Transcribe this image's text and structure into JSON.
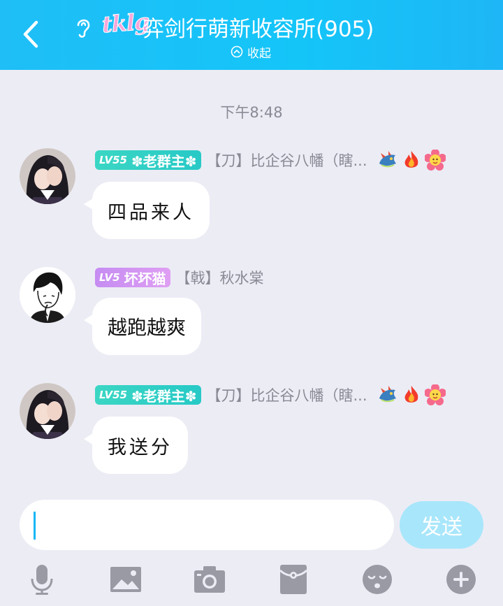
{
  "header": {
    "back_label": "返回",
    "logo_text": "tklg",
    "title": "弈剑行萌新收容所(905)",
    "collapse_label": "收起"
  },
  "chat": {
    "timestamp": "下午8:48",
    "messages": [
      {
        "badge_level": "LV55",
        "badge_title": "✽老群主✽",
        "badge_color": "#2ecdc6",
        "sender": "【刀】比企谷八幡（瞎...",
        "text": "四品来人",
        "avatar_icon": "anime-couple-avatar"
      },
      {
        "badge_level": "LV5",
        "badge_title": "坏坏猫",
        "badge_color": "#d596f3",
        "sender": "【戟】秋水棠",
        "text": "越跑越爽",
        "avatar_icon": "sketch-boy-avatar"
      },
      {
        "badge_level": "LV55",
        "badge_title": "✽老群主✽",
        "badge_color": "#2ecdc6",
        "sender": "【刀】比企谷八幡（瞎...",
        "text": "我送分",
        "avatar_icon": "anime-couple-avatar"
      }
    ]
  },
  "composer": {
    "input_value": "",
    "send_label": "发送"
  },
  "toolbar": {
    "icons": [
      "microphone-icon",
      "image-icon",
      "camera-icon",
      "red-packet-icon",
      "emoji-icon",
      "plus-icon"
    ]
  },
  "colors": {
    "header_bg": "#19bff8",
    "page_bg": "#ececf5",
    "send_button": "#a8e6fb",
    "toolbar_icon": "#9a9aa4"
  }
}
